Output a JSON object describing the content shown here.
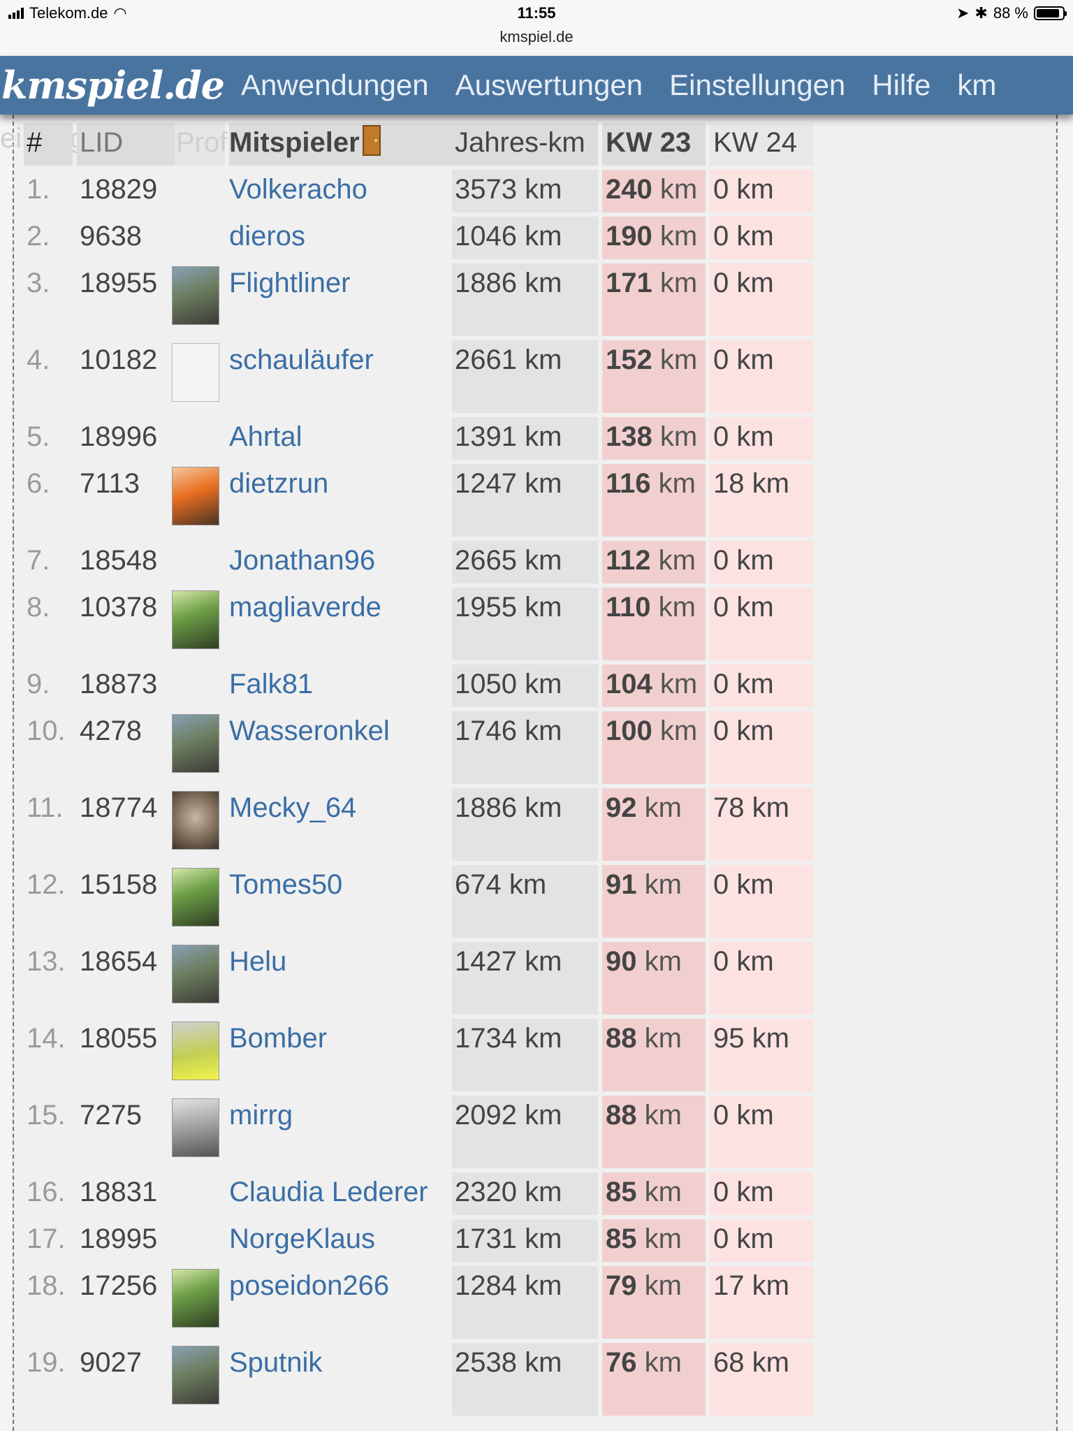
{
  "status_bar": {
    "carrier": "Telekom.de",
    "time": "11:55",
    "url": "kmspiel.de",
    "battery": "88 %",
    "battery_level": 0.88
  },
  "nav": {
    "logo": "kmspiel.de",
    "links": [
      "Anwendungen",
      "Auswertungen",
      "Einstellungen",
      "Hilfe",
      "km"
    ]
  },
  "ghost_text": "eintragen",
  "table": {
    "headers": {
      "rank": "#",
      "lid": "LID",
      "profile": "Profil",
      "player": "Mitspieler",
      "year_km": "Jahres-km",
      "kw23": "KW 23",
      "kw24": "KW 24"
    },
    "rows": [
      {
        "rank": "1.",
        "lid": "18829",
        "avatar": "none",
        "name": "Volkeracho",
        "year_km": "3573 km",
        "kw23_val": "240",
        "kw23_unit": " km",
        "kw24": "0 km"
      },
      {
        "rank": "2.",
        "lid": "9638",
        "avatar": "none",
        "name": "dieros",
        "year_km": "1046 km",
        "kw23_val": "190",
        "kw23_unit": " km",
        "kw24": "0 km"
      },
      {
        "rank": "3.",
        "lid": "18955",
        "avatar": "photo",
        "name": "Flightliner",
        "year_km": "1886 km",
        "kw23_val": "171",
        "kw23_unit": " km",
        "kw24": "0 km"
      },
      {
        "rank": "4.",
        "lid": "10182",
        "avatar": "empty",
        "name": "schauläufer",
        "year_km": "2661 km",
        "kw23_val": "152",
        "kw23_unit": " km",
        "kw24": "0 km"
      },
      {
        "rank": "5.",
        "lid": "18996",
        "avatar": "none",
        "name": "Ahrtal",
        "year_km": "1391 km",
        "kw23_val": "138",
        "kw23_unit": " km",
        "kw24": "0 km"
      },
      {
        "rank": "6.",
        "lid": "7113",
        "avatar": "warm",
        "name": "dietzrun",
        "year_km": "1247 km",
        "kw23_val": "116",
        "kw23_unit": " km",
        "kw24": "18 km"
      },
      {
        "rank": "7.",
        "lid": "18548",
        "avatar": "none",
        "name": "Jonathan96",
        "year_km": "2665 km",
        "kw23_val": "112",
        "kw23_unit": " km",
        "kw24": "0 km"
      },
      {
        "rank": "8.",
        "lid": "10378",
        "avatar": "green",
        "name": "magliaverde",
        "year_km": "1955 km",
        "kw23_val": "110",
        "kw23_unit": " km",
        "kw24": "0 km"
      },
      {
        "rank": "9.",
        "lid": "18873",
        "avatar": "none",
        "name": "Falk81",
        "year_km": "1050 km",
        "kw23_val": "104",
        "kw23_unit": " km",
        "kw24": "0 km"
      },
      {
        "rank": "10.",
        "lid": "4278",
        "avatar": "photo",
        "name": "Wasseronkel",
        "year_km": "1746 km",
        "kw23_val": "100",
        "kw23_unit": " km",
        "kw24": "0 km"
      },
      {
        "rank": "11.",
        "lid": "18774",
        "avatar": "plush",
        "name": "Mecky_64",
        "year_km": "1886 km",
        "kw23_val": "92",
        "kw23_unit": " km",
        "kw24": "78 km"
      },
      {
        "rank": "12.",
        "lid": "15158",
        "avatar": "green",
        "name": "Tomes50",
        "year_km": "674 km",
        "kw23_val": "91",
        "kw23_unit": " km",
        "kw24": "0 km"
      },
      {
        "rank": "13.",
        "lid": "18654",
        "avatar": "photo",
        "name": "Helu",
        "year_km": "1427 km",
        "kw23_val": "90",
        "kw23_unit": " km",
        "kw24": "0 km"
      },
      {
        "rank": "14.",
        "lid": "18055",
        "avatar": "yellow",
        "name": "Bomber",
        "year_km": "1734 km",
        "kw23_val": "88",
        "kw23_unit": " km",
        "kw24": "95 km"
      },
      {
        "rank": "15.",
        "lid": "7275",
        "avatar": "grey",
        "name": "mirrg",
        "year_km": "2092 km",
        "kw23_val": "88",
        "kw23_unit": " km",
        "kw24": "0 km"
      },
      {
        "rank": "16.",
        "lid": "18831",
        "avatar": "none",
        "name": "Claudia Lederer",
        "year_km": "2320 km",
        "kw23_val": "85",
        "kw23_unit": " km",
        "kw24": "0 km"
      },
      {
        "rank": "17.",
        "lid": "18995",
        "avatar": "none",
        "name": "NorgeKlaus",
        "year_km": "1731 km",
        "kw23_val": "85",
        "kw23_unit": " km",
        "kw24": "0 km"
      },
      {
        "rank": "18.",
        "lid": "17256",
        "avatar": "green",
        "name": "poseidon266",
        "year_km": "1284 km",
        "kw23_val": "79",
        "kw23_unit": " km",
        "kw24": "17 km"
      },
      {
        "rank": "19.",
        "lid": "9027",
        "avatar": "photo",
        "name": "Sputnik",
        "year_km": "2538 km",
        "kw23_val": "76",
        "kw23_unit": " km",
        "kw24": "68 km"
      }
    ]
  }
}
